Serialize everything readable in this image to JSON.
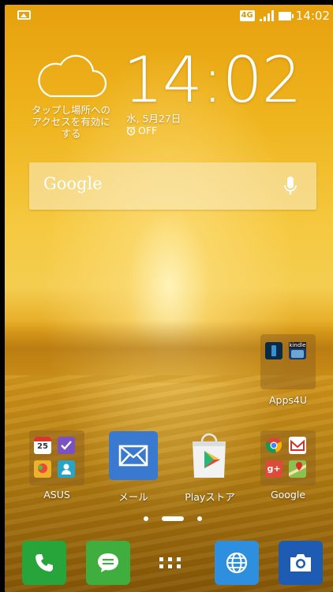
{
  "status_bar": {
    "network": "4G",
    "time": "14:02",
    "icons": [
      "image-icon",
      "signal-icon",
      "battery-icon"
    ]
  },
  "weather": {
    "icon": "cloud-icon",
    "text_line1": "タップし場所への",
    "text_line2": "アクセスを有効に",
    "text_line3": "する"
  },
  "clock": {
    "time": "14:02",
    "date": "水, 5月27日",
    "alarm": "OFF"
  },
  "search": {
    "logo": "Google",
    "icon": "mic-icon"
  },
  "folders": {
    "apps4u": {
      "label": "Apps4U",
      "mini_icons": [
        "ebook-icon",
        "kindle-icon"
      ],
      "kindle_text": "kindle"
    },
    "asus": {
      "label": "ASUS",
      "calendar_day": "25"
    },
    "google": {
      "label": "Google"
    }
  },
  "apps": {
    "mail": {
      "label": "メール"
    },
    "play": {
      "label": "Playストア"
    }
  },
  "page_indicator": {
    "pages": 3,
    "current": 2
  },
  "dock": {
    "items": [
      "phone-icon",
      "messages-icon",
      "all-apps-icon",
      "browser-icon",
      "camera-icon"
    ]
  },
  "colors": {
    "phone": "#27a43a",
    "messages": "#3fae3f",
    "browser": "#2d8fde",
    "camera": "#1e5cb3",
    "mail": "#3a79d0"
  }
}
